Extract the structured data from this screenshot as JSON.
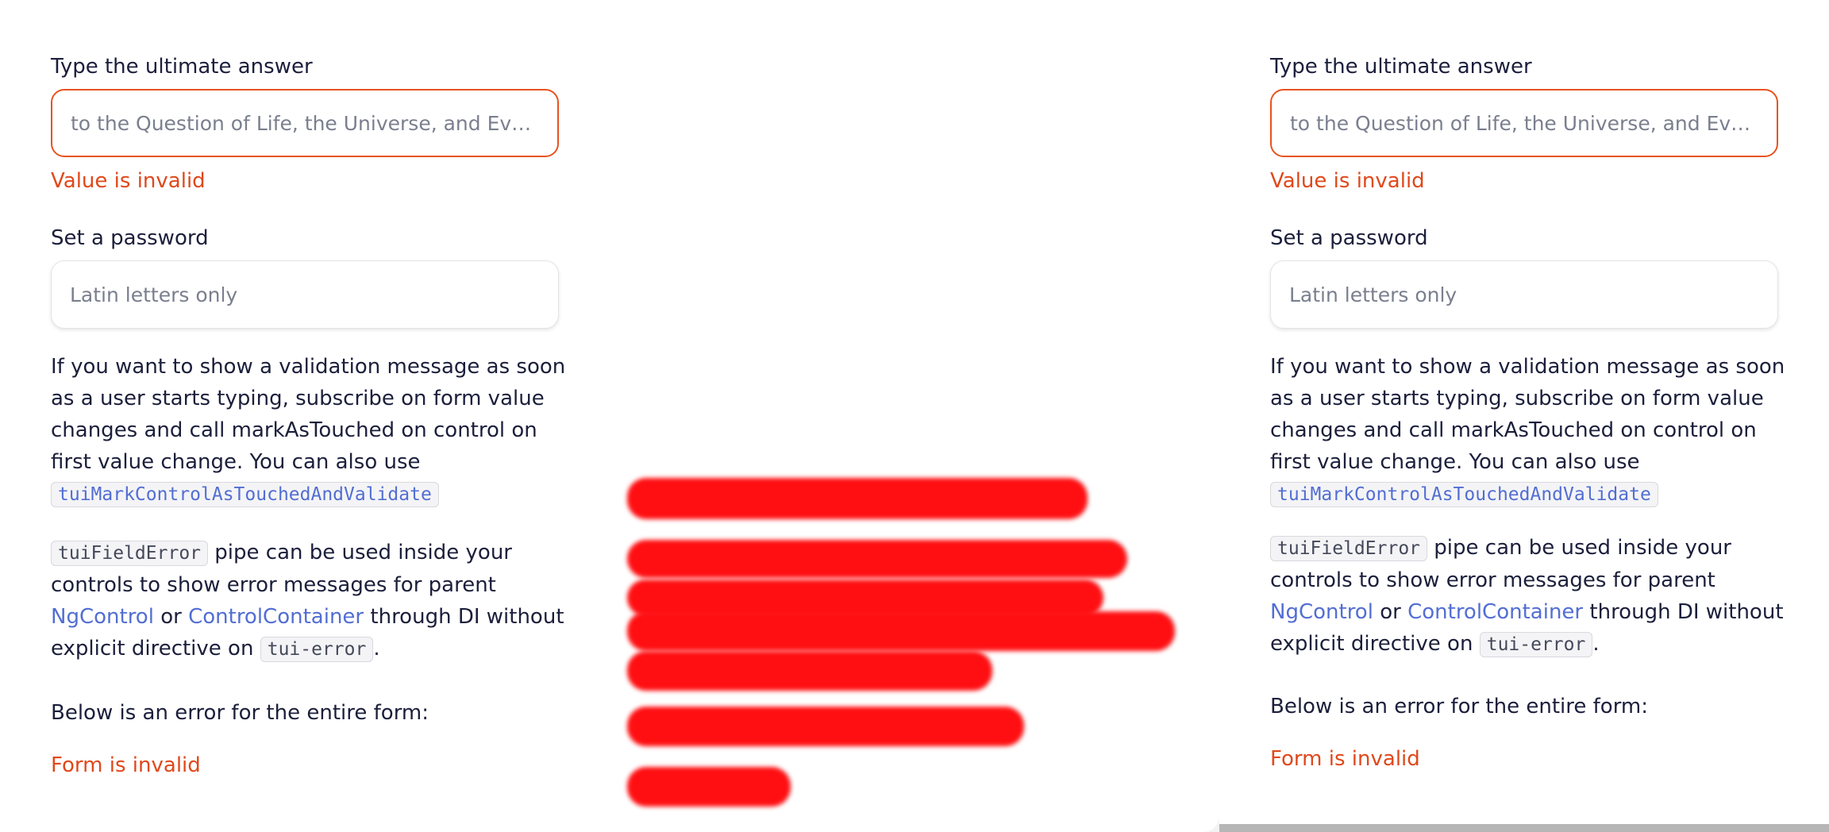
{
  "left_form": {
    "answer_label": "Type the ultimate answer",
    "answer_placeholder": "to the Question of Life, the Universe, and Every…",
    "answer_error": "Value is invalid",
    "password_label": "Set a password",
    "password_placeholder": "Latin letters only",
    "info_text": "If you want to show a validation message as soon as a user starts typing, subscribe on form value changes and call markAsTouched on control on first value change. You can also use",
    "info_code": "tuiMarkControlAsTouchedAndValidate",
    "pipe_code": "tuiFieldError",
    "pipe_text_1": "pipe can be used inside your controls to show error messages for parent",
    "ngcontrol_link": "NgControl",
    "or_text": "or",
    "controlcontainer_link": "ControlContainer",
    "pipe_text_2": "through DI without explicit directive on",
    "tui_error_code": "tui-error",
    "period": ".",
    "form_error_label": "Below is an error for the entire form:",
    "form_error": "Form is invalid"
  },
  "right_form": {
    "answer_label": "Type the ultimate answer",
    "answer_placeholder": "to the Question of Life, the Universe, and Every…",
    "answer_error": "Value is invalid",
    "password_label": "Set a password",
    "password_placeholder": "Latin letters only",
    "info_text": "If you want to show a validation message as soon as a user starts typing, subscribe on form value changes and call markAsTouched on control on first value change. You can also use",
    "info_code": "tuiMarkControlAsTouchedAndValidate",
    "pipe_code": "tuiFieldError",
    "pipe_text_1": "pipe can be used inside your controls to show error messages for parent",
    "ngcontrol_link": "NgControl",
    "or_text": "or",
    "controlcontainer_link": "ControlContainer",
    "pipe_text_2": "through DI without explicit directive on",
    "tui_error_code": "tui-error",
    "period": ".",
    "form_error_label": "Below is an error for the entire form:",
    "form_error": "Form is invalid"
  },
  "colors": {
    "error": "#e0481b",
    "invalid_border": "#e8531f",
    "link": "#526ed3",
    "redaction": "#ff0f12"
  }
}
